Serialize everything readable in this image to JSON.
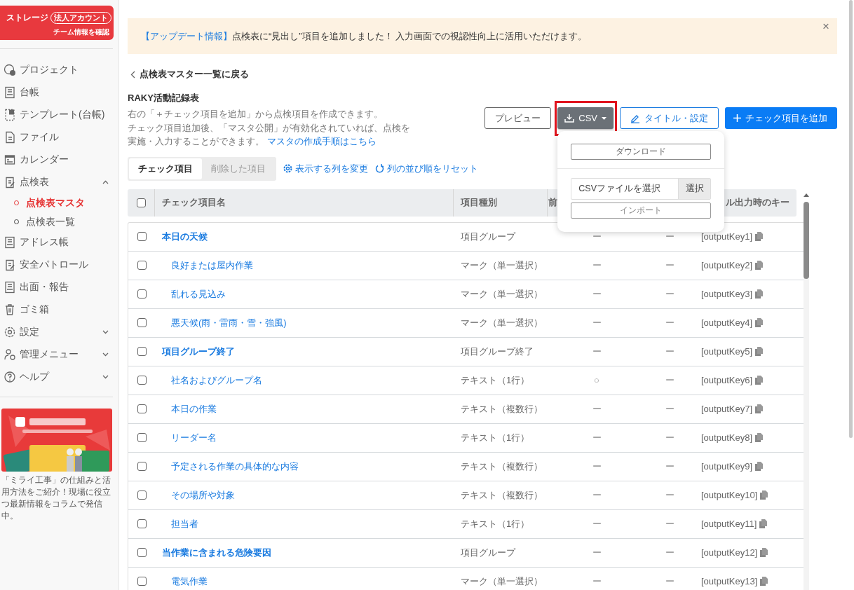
{
  "sidebar": {
    "account_card": {
      "title": "ストレージ",
      "badge": "法人アカウント",
      "link": "チーム情報を確認"
    },
    "items": [
      {
        "label": "プロジェクト",
        "kind": "project"
      },
      {
        "label": "台帳",
        "kind": "ledger"
      },
      {
        "label": "テンプレート(台帳)",
        "kind": "template"
      },
      {
        "label": "ファイル",
        "kind": "file"
      },
      {
        "label": "カレンダー",
        "kind": "calendar"
      },
      {
        "label": "点検表",
        "kind": "clipboard",
        "expanded": true,
        "children": [
          {
            "label": "点検表マスタ",
            "selected": true
          },
          {
            "label": "点検表一覧",
            "selected": false
          }
        ]
      },
      {
        "label": "アドレス帳",
        "kind": "ledger"
      },
      {
        "label": "安全パトロール",
        "kind": "clipboard"
      },
      {
        "label": "出面・報告",
        "kind": "ledger"
      },
      {
        "label": "ゴミ箱",
        "kind": "trash"
      },
      {
        "label": "設定",
        "kind": "gear",
        "expanded": false
      },
      {
        "label": "管理メニュー",
        "kind": "user",
        "expanded": false
      },
      {
        "label": "ヘルプ",
        "kind": "help",
        "expanded": false
      }
    ],
    "promo": {
      "kind": "picture",
      "caption": "「ミライ工事」の仕組みと活用方法をご紹介！現場に役立つ最新情報をコラムで発信中。"
    }
  },
  "banner": {
    "label": "【アップデート情報】",
    "text": "点検表に“見出し”項目を追加しました！ 入力画面での視認性向上に活用いただけます。",
    "close": "×"
  },
  "back_link": "点検表マスター一覧に戻る",
  "title": "RAKY活動記録表",
  "description_lines": [
    "右の「＋チェック項目を追加」から点検項目を作成できます。",
    "チェック項目追加後、「マスタ公開」が有効化されていれば、点検を",
    "実施・入力することができます。"
  ],
  "description_link": "マスタの作成手順はこちら",
  "actions": {
    "preview": "プレビュー",
    "csv": "CSV",
    "csv_highlighted": true,
    "settings": "タイトル・設定",
    "add": "チェック項目を追加"
  },
  "csv_menu": {
    "download": "ダウンロード",
    "file_placeholder": "CSVファイルを選択",
    "choose": "選択",
    "import": "インポート"
  },
  "tabs": [
    {
      "label": "チェック項目",
      "selected": true
    },
    {
      "label": "削除した項目",
      "selected": false
    }
  ],
  "tools": [
    {
      "label": "表示する列を変更",
      "kind": "gear"
    },
    {
      "label": "列の並び順をリセット",
      "kind": "reset"
    }
  ],
  "table": {
    "select_all_checked": false,
    "columns": [
      "チェック項目名",
      "項目種別",
      "前",
      "ル出力時のキー"
    ],
    "rows": [
      {
        "name": "本日の天候",
        "kind": "group",
        "type": "項目グループ",
        "column_3": "ー",
        "column_4": "ー",
        "key": "[outputKey1]",
        "checked": false
      },
      {
        "name": "良好または屋内作業",
        "kind": "item",
        "type": "マーク（単一選択）",
        "column_3": "ー",
        "column_4": "ー",
        "key": "[outputKey2]",
        "checked": false
      },
      {
        "name": "乱れる見込み",
        "kind": "item",
        "type": "マーク（単一選択）",
        "column_3": "ー",
        "column_4": "ー",
        "key": "[outputKey3]",
        "checked": false
      },
      {
        "name": "悪天候(雨・雷雨・雪・強風)",
        "kind": "item",
        "type": "マーク（単一選択）",
        "column_3": "ー",
        "column_4": "ー",
        "key": "[outputKey4]",
        "checked": false
      },
      {
        "name": "項目グループ終了",
        "kind": "group",
        "type": "項目グループ終了",
        "column_3": "ー",
        "column_4": "ー",
        "key": "[outputKey5]",
        "checked": false
      },
      {
        "name": "社名およびグループ名",
        "kind": "item",
        "type": "テキスト（1行）",
        "column_3": "○",
        "column_4": "ー",
        "key": "[outputKey6]",
        "checked": false
      },
      {
        "name": "本日の作業",
        "kind": "item",
        "type": "テキスト（複数行）",
        "column_3": "ー",
        "column_4": "ー",
        "key": "[outputKey7]",
        "checked": false
      },
      {
        "name": "リーダー名",
        "kind": "item",
        "type": "テキスト（1行）",
        "column_3": "ー",
        "column_4": "ー",
        "key": "[outputKey8]",
        "checked": false
      },
      {
        "name": "予定される作業の具体的な内容",
        "kind": "item",
        "type": "テキスト（複数行）",
        "column_3": "ー",
        "column_4": "ー",
        "key": "[outputKey9]",
        "checked": false
      },
      {
        "name": "その場所や対象",
        "kind": "item",
        "type": "テキスト（複数行）",
        "column_3": "ー",
        "column_4": "ー",
        "key": "[outputKey10]",
        "checked": false
      },
      {
        "name": "担当者",
        "kind": "item",
        "type": "テキスト（1行）",
        "column_3": "ー",
        "column_4": "ー",
        "key": "[outputKey11]",
        "checked": false
      },
      {
        "name": "当作業に含まれる危険要因",
        "kind": "group",
        "type": "項目グループ",
        "column_3": "ー",
        "column_4": "ー",
        "key": "[outputKey12]",
        "checked": false
      },
      {
        "name": "電気作業",
        "kind": "item",
        "type": "マーク（単一選択）",
        "column_3": "ー",
        "column_4": "ー",
        "key": "[outputKey13]",
        "checked": false
      }
    ]
  }
}
